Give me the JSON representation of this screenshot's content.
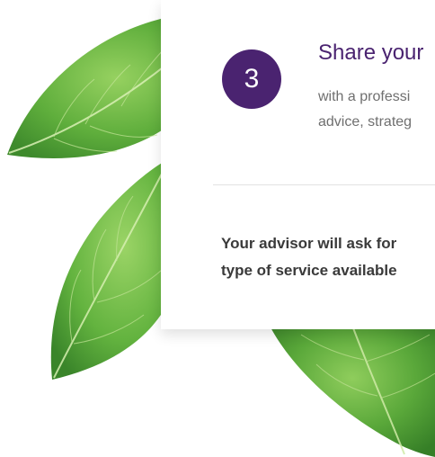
{
  "step": {
    "number": "3",
    "title": "Share your",
    "description_lines": [
      "with a professi",
      "advice, strateg"
    ]
  },
  "note": {
    "lines": [
      "Your advisor will ask for",
      "type of service available"
    ]
  },
  "colors": {
    "accent": "#4a2370",
    "leaf_dark": "#3f8a2e",
    "leaf_light": "#8fcc5c"
  }
}
